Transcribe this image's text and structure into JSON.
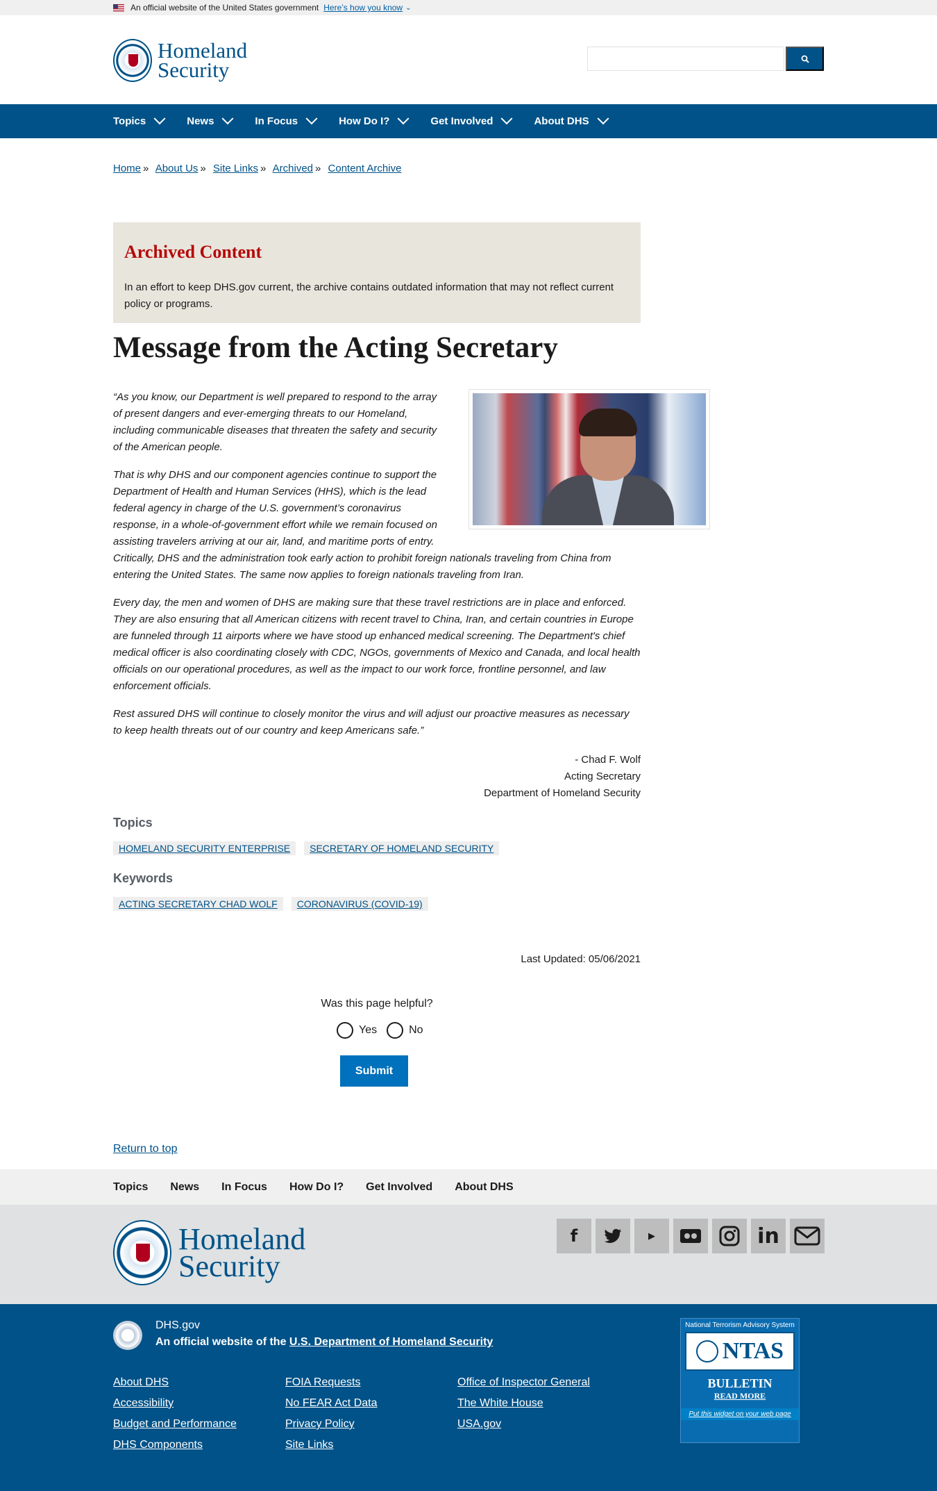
{
  "gov_banner": {
    "text": "An official website of the United States government",
    "how_link": "Here’s how you know"
  },
  "header": {
    "logo_line1": "Homeland",
    "logo_line2": "Security",
    "search_placeholder": ""
  },
  "nav": {
    "items": [
      "Topics",
      "News",
      "In Focus",
      "How Do I?",
      "Get Involved",
      "About DHS"
    ]
  },
  "breadcrumb": [
    "Home",
    "About Us",
    "Site Links",
    "Archived",
    "Content Archive"
  ],
  "archived": {
    "title": "Archived Content",
    "text": "In an effort to keep DHS.gov current, the archive contains outdated information that may not reflect current policy or programs."
  },
  "page_title": "Message from the Acting Secretary",
  "article": {
    "p1": "“As you know, our Department is well prepared to respond to the array of present dangers and ever-emerging threats to our Homeland, including communicable diseases that threaten the safety and security of the American people.",
    "p2a": "That is why DHS and our component agencies continue to support the Department of Health and Human Services (HHS), which is the lead federal agency in charge of the U.S. government’s coronavirus response, in a whole-of-government effort while we remain focused on assisting travelers arriving at our air, land, and maritime ports of entry.",
    "p2b": "Critically, DHS and the administration took early action to prohibit foreign nationals traveling from China from entering the United States. The same now applies to foreign nationals traveling from Iran.",
    "p3": "Every day, the men and women of DHS are making sure that these travel restrictions are in place and enforced. They are also ensuring that all American citizens with recent travel to China, Iran, and certain countries in Europe are funneled through 11 airports where we have stood up enhanced medical screening. The Department's chief medical officer is also coordinating closely with CDC, NGOs, governments of Mexico and Canada, and local health officials on our operational procedures, as well as the impact to our work force, frontline personnel, and law enforcement officials.",
    "p4": "Rest assured DHS will continue to closely monitor the virus and will adjust our proactive measures as necessary to keep health threats out of our country and keep Americans safe.”",
    "sig_name": "- Chad F. Wolf",
    "sig_title": "Acting Secretary",
    "sig_dept": "Department of Homeland Security"
  },
  "topics": {
    "label": "Topics",
    "tags": [
      "HOMELAND SECURITY ENTERPRISE",
      "SECRETARY OF HOMELAND SECURITY"
    ]
  },
  "keywords": {
    "label": "Keywords",
    "tags": [
      "ACTING SECRETARY CHAD WOLF",
      "CORONAVIRUS (COVID-19)"
    ]
  },
  "last_updated": "Last Updated: 05/06/2021",
  "feedback": {
    "question": "Was this page helpful?",
    "yes": "Yes",
    "no": "No",
    "submit": "Submit"
  },
  "return_top": "Return to top",
  "footer_nav": [
    "Topics",
    "News",
    "In Focus",
    "How Do I?",
    "Get Involved",
    "About DHS"
  ],
  "footer_logo": {
    "line1": "Homeland",
    "line2": "Security"
  },
  "socials": [
    "facebook-icon",
    "twitter-icon",
    "youtube-icon",
    "flickr-icon",
    "instagram-icon",
    "linkedin-icon",
    "email-icon"
  ],
  "footer_bottom": {
    "domain": "DHS.gov",
    "official_prefix": "An official website of the",
    "official_link": "U.S. Department of Homeland Security",
    "links": [
      "About DHS",
      "FOIA Requests",
      "Office of Inspector General",
      "Accessibility",
      "No FEAR Act Data",
      "The White House",
      "Budget and Performance",
      "Privacy Policy",
      "USA.gov",
      "DHS Components",
      "Site Links"
    ]
  },
  "ntas": {
    "top": "National Terrorism Advisory System",
    "name": "NTAS",
    "bulletin": "BULLETIN",
    "read_more": "READ MORE",
    "widget": "Put this widget on your web page"
  },
  "colors": {
    "primary": "#005288",
    "archived_bg": "#e8e5dc",
    "archived_title": "#b50909",
    "submit": "#0071bc"
  }
}
